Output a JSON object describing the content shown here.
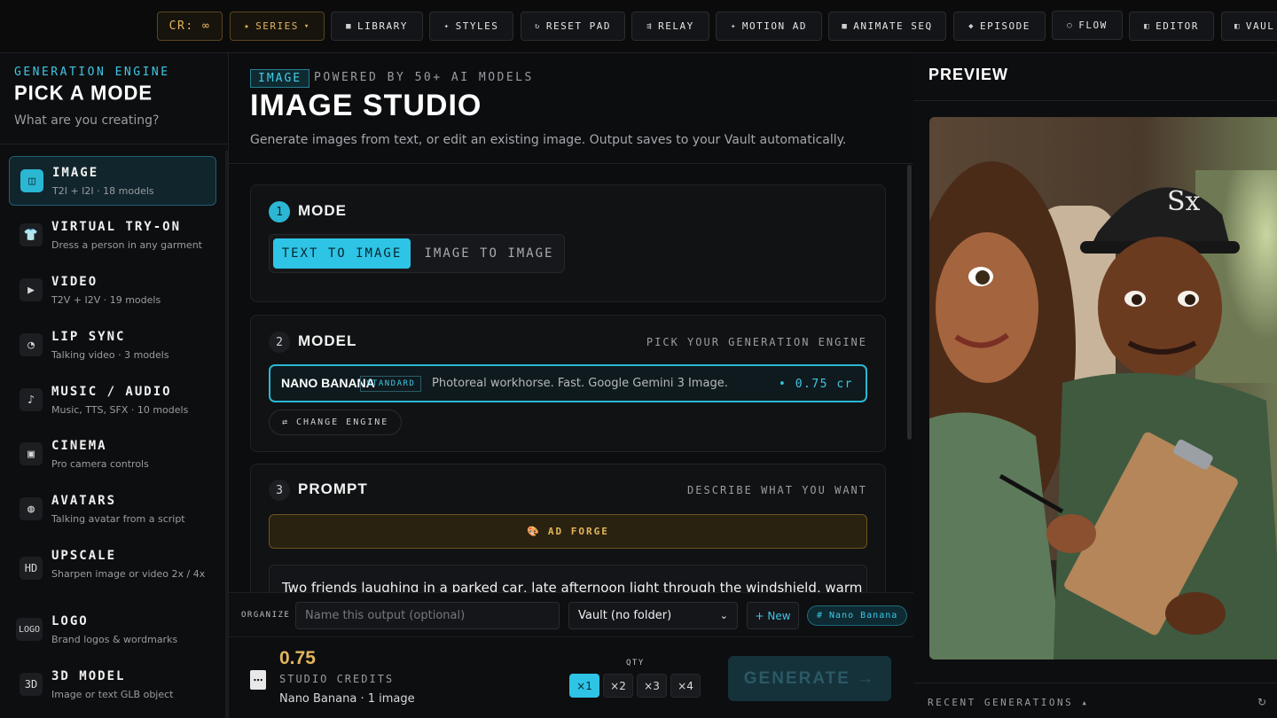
{
  "topbar": {
    "credits": "CR: ∞",
    "buttons": [
      {
        "icon": "★",
        "label": "SERIES",
        "suffix": "▾"
      },
      {
        "icon": "■",
        "label": "LIBRARY"
      },
      {
        "icon": "✦",
        "label": "STYLES"
      },
      {
        "icon": "↻",
        "label": "RESET PAD"
      },
      {
        "icon": "⇶",
        "label": "RELAY"
      },
      {
        "icon": "✦",
        "label": "MOTION AD"
      },
      {
        "icon": "■",
        "label": "ANIMATE SEQ"
      },
      {
        "icon": "◆",
        "label": "EPISODE"
      },
      {
        "icon": "○",
        "label": "FLOW"
      },
      {
        "icon": "◧",
        "label": "EDITOR"
      },
      {
        "icon": "◧",
        "label": "VAUL"
      }
    ]
  },
  "sidebar": {
    "kicker": "GENERATION ENGINE",
    "title": "PICK A MODE",
    "subtitle": "What are you creating?",
    "modes": [
      {
        "icon": "◫",
        "label": "IMAGE",
        "desc": "T2I + I2I · 18 models"
      },
      {
        "icon": "👕",
        "label": "VIRTUAL TRY-ON",
        "desc": "Dress a person in any garment"
      },
      {
        "icon": "▶",
        "label": "VIDEO",
        "desc": "T2V + I2V · 19 models"
      },
      {
        "icon": "◔",
        "label": "LIP SYNC",
        "desc": "Talking video · 3 models"
      },
      {
        "icon": "♪",
        "label": "MUSIC / AUDIO",
        "desc": "Music, TTS, SFX · 10 models"
      },
      {
        "icon": "▣",
        "label": "CINEMA",
        "desc": "Pro camera controls"
      },
      {
        "icon": "◍",
        "label": "AVATARS",
        "desc": "Talking avatar from a script"
      },
      {
        "icon": "HD",
        "label": "UPSCALE",
        "desc": "Sharpen image or video 2x / 4x"
      },
      {
        "icon": "LOGO",
        "label": "LOGO",
        "desc": "Brand logos & wordmarks"
      },
      {
        "icon": "3D",
        "label": "3D MODEL",
        "desc": "Image or text GLB object"
      }
    ]
  },
  "main": {
    "pill": "IMAGE",
    "powered": "POWERED BY 50+ AI MODELS",
    "title": "IMAGE STUDIO",
    "subtitle": "Generate images from text, or edit an existing image. Output saves to your Vault automatically.",
    "mode": {
      "num": "1",
      "title": "MODE",
      "options": [
        "TEXT TO IMAGE",
        "IMAGE TO IMAGE"
      ]
    },
    "model": {
      "num": "2",
      "title": "MODEL",
      "hint": "PICK YOUR GENERATION ENGINE",
      "name": "NANO BANANA",
      "tier": "STANDARD",
      "desc": "Photoreal workhorse. Fast. Google Gemini 3 Image.",
      "cost": "• 0.75 cr",
      "change": "⇄  CHANGE ENGINE"
    },
    "prompt": {
      "num": "3",
      "title": "PROMPT",
      "hint": "DESCRIBE WHAT YOU WANT",
      "adforge": "AD FORGE",
      "text": "Two friends laughing in a parked car, late afternoon light through the windshield, warm film"
    },
    "organize": {
      "label": "ORGANIZE",
      "placeholder": "Name this output (optional)",
      "folder": "Vault (no folder)",
      "new": "+ New",
      "tag": "# Nano Banana"
    },
    "footer": {
      "cost": "0.75",
      "label": "STUDIO CREDITS",
      "meta": "Nano Banana · 1 image",
      "qty_label": "QTY",
      "qty": [
        "×1",
        "×2",
        "×3",
        "×4"
      ],
      "generate": "GENERATE →"
    }
  },
  "preview": {
    "title": "PREVIEW",
    "recent": "RECENT GENERATIONS ▴",
    "refresh": "↻"
  },
  "colors": {
    "accent": "#2ec4e6",
    "gold": "#e3b55c",
    "bg": "#0c0d0f"
  }
}
